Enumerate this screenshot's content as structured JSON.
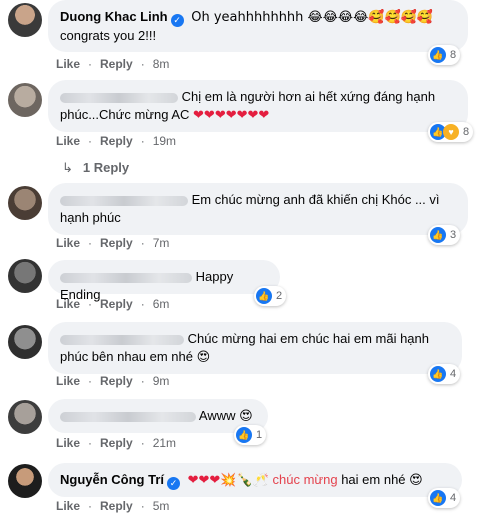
{
  "actions": {
    "like": "Like",
    "reply": "Reply",
    "dot": "·"
  },
  "comments": [
    {
      "author": "Duong Khac Linh",
      "text1": "Oh yeahhhhhhhh 😂😂😂😂🥰🥰🥰🥰",
      "text2": "congrats you 2!!!",
      "time": "8m",
      "reactions": "8"
    },
    {
      "text1": "Chị em là người hơn ai hết xứng đáng hạnh",
      "text2": "phúc...Chức mừng AC",
      "hearts": "❤❤❤❤❤❤❤",
      "time": "19m",
      "reactions": "8",
      "replies": "1 Reply"
    },
    {
      "text1": "Em chúc mừng anh đã khiến chị Khóc ... vì",
      "text2": "hạnh phúc",
      "time": "7m",
      "reactions": "3"
    },
    {
      "text1": "Happy Ending",
      "time": "6m",
      "reactions": "2"
    },
    {
      "text1": "Chúc mừng hai em chúc hai em mãi hạnh",
      "text2": "phúc bên nhau em nhé 😍",
      "time": "9m",
      "reactions": "4"
    },
    {
      "text1": "Awww 😍",
      "time": "21m",
      "reactions": "1"
    },
    {
      "author": "Nguyễn Công Trí",
      "emojis": "❤❤❤💥🍾🥂",
      "highlight": "chúc mừng",
      "text1": "hai em nhé 😍",
      "time": "5m",
      "reactions": "4"
    }
  ],
  "colors": {
    "like_blue": "#1877f2",
    "love_red": "#f33e58",
    "bubble": "#f0f2f5",
    "meta": "#65676b"
  }
}
